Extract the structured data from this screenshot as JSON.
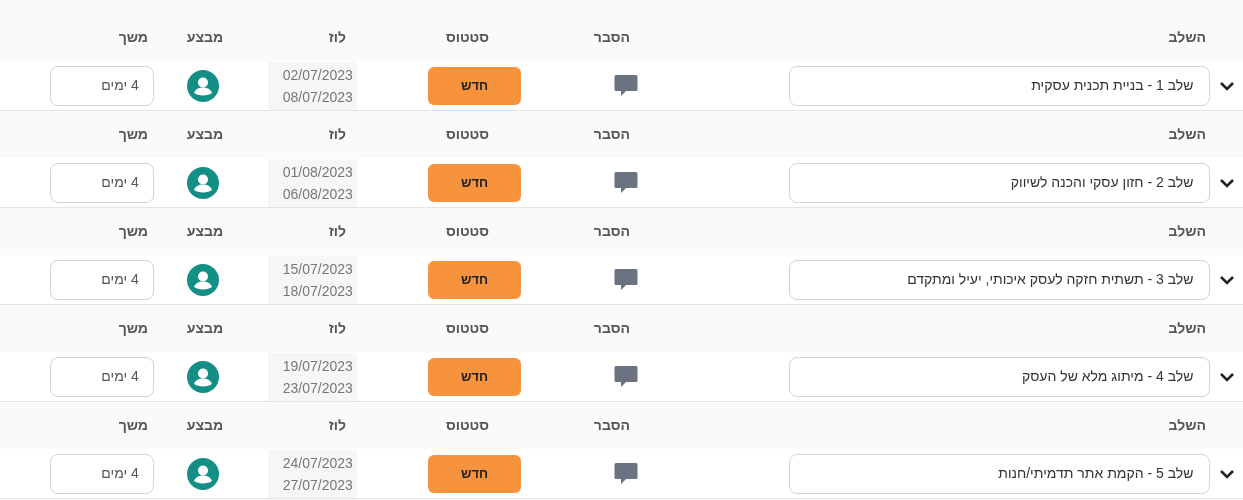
{
  "stages": [
    {
      "headers": [
        "השלב",
        "הסבר",
        "סטטוס",
        "לוז",
        "מבצע",
        "משך"
      ],
      "name": "שלב 1 - בניית תכנית עסקית",
      "status": "חדש",
      "start": "02/07/2023",
      "end": "08/07/2023",
      "duration": "4 ימים"
    },
    {
      "headers": [
        "השלב",
        "הסבר",
        "סטטוס",
        "לוז",
        "מבצע",
        "משך"
      ],
      "name": "שלב 2 - חזון עסקי והכנה לשיווק",
      "status": "חדש",
      "start": "01/08/2023",
      "end": "06/08/2023",
      "duration": "4 ימים"
    },
    {
      "headers": [
        "השלב",
        "הסבר",
        "סטטוס",
        "לוז",
        "מבצע",
        "משך"
      ],
      "name": "שלב 3 - תשתית חזקה לעסק איכותי, יעיל ומתקדם",
      "status": "חדש",
      "start": "15/07/2023",
      "end": "18/07/2023",
      "duration": "4 ימים"
    },
    {
      "headers": [
        "השלב",
        "הסבר",
        "סטטוס",
        "לוז",
        "מבצע",
        "משך"
      ],
      "name": "שלב 4 - מיתוג מלא של העסק",
      "status": "חדש",
      "start": "19/07/2023",
      "end": "23/07/2023",
      "duration": "4 ימים"
    },
    {
      "headers": [
        "השלב",
        "הסבר",
        "סטטוס",
        "לוז",
        "מבצע",
        "משך"
      ],
      "name": "שלב 5 - הקמת אתר תדמיתי/חנות",
      "status": "חדש",
      "start": "24/07/2023",
      "end": "27/07/2023",
      "duration": "4 ימים"
    }
  ]
}
